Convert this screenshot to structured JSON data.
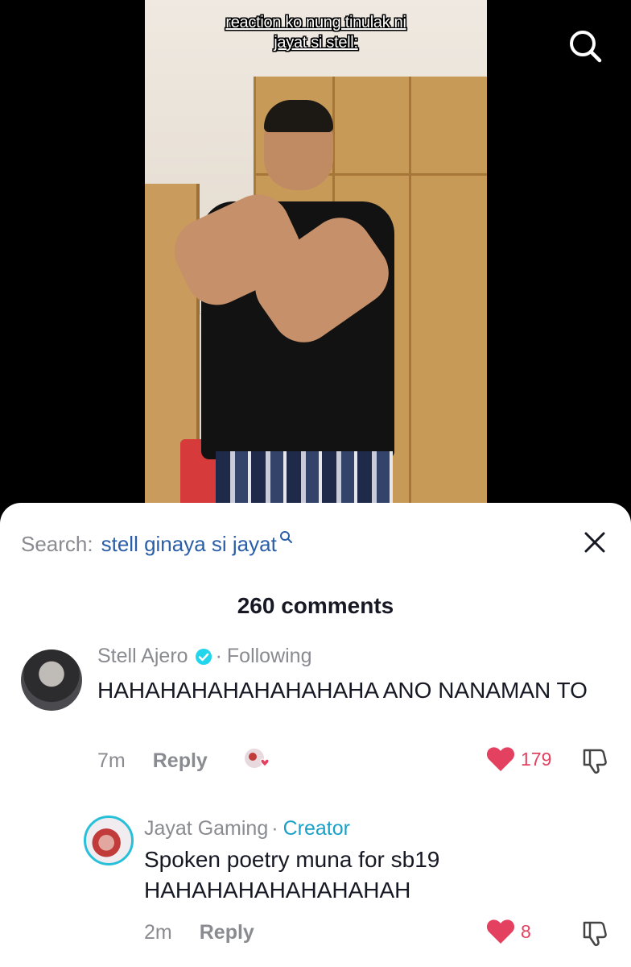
{
  "video": {
    "caption_line1": "reaction ko nung tinulak ni",
    "caption_line2": "jayat si stell:",
    "search_icon": "search-icon"
  },
  "comments_panel": {
    "search_prefix": "Search:",
    "search_query": "stell ginaya si jayat",
    "close_icon": "close-icon",
    "comment_count": "260 comments",
    "comments": [
      {
        "author": "Stell Ajero",
        "verified": true,
        "separator": "·",
        "relation": "Following",
        "text": "HAHAHAHAHAHAHAHAHA ANO NANAMAN TO",
        "time": "7m",
        "reply_label": "Reply",
        "likes": "179",
        "liked": true
      },
      {
        "author": "Jayat Gaming",
        "separator": "·",
        "relation": "Creator",
        "text": "Spoken poetry muna for sb19 HAHAHAHAHAHAHAHAH",
        "time": "2m",
        "reply_label": "Reply",
        "likes": "8",
        "liked": true
      }
    ]
  },
  "colors": {
    "like_red": "#e4405f",
    "link_blue": "#2b5ea8",
    "creator_teal": "#1aa1c7",
    "muted_gray": "#8a8b91",
    "text_dark": "#161823"
  }
}
